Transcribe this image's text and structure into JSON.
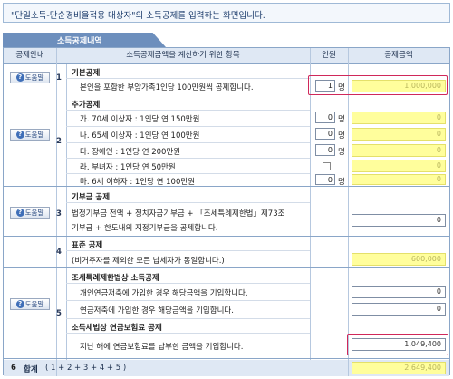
{
  "banner": "\"단일소득-단순경비율적용 대상자\"의 소득공제를 입력하는 화면입니다.",
  "section_title": "소득공제내역",
  "headers": {
    "guide": "공제안내",
    "items": "소득공제금액을 계산하기 위한 항목",
    "people": "인원",
    "amount": "공제금액"
  },
  "help_label": "도움말",
  "rows": {
    "r1": {
      "num": "1",
      "title": "기본공제",
      "desc": "본인을 포함한 부양가족1인당 100만원씩 공제합니다.",
      "count": "1",
      "amount": "1,000,000"
    },
    "r2": {
      "num": "2",
      "title": "추가공제",
      "lines": [
        {
          "text": "가. 70세 이상자 : 1인당 연 150만원",
          "count": "0",
          "amount": "0"
        },
        {
          "text": "나. 65세 이상자 : 1인당 연 100만원",
          "count": "0",
          "amount": "0"
        },
        {
          "text": "다. 장애인      : 1인당 연 200만원",
          "count": "0",
          "amount": "0"
        },
        {
          "text": "라. 부녀자      : 1인당 연  50만원",
          "amount": "0"
        },
        {
          "text": "마. 6세  이하자 : 1인당 연 100만원",
          "count": "0",
          "amount": "0"
        }
      ]
    },
    "r3": {
      "num": "3",
      "title": "기부금 공제",
      "desc1": "법정기부금 전액 + 정치자금기부금 + 「조세특례제한법」제73조",
      "desc2": "기부금 + 한도내의 지정기부금을 공제합니다.",
      "amount": "0"
    },
    "r4": {
      "num": "4",
      "title": "표준 공제",
      "desc": "(비거주자를 제외한 모든 납세자가 동일합니다.)",
      "amount": "600,000"
    },
    "r5": {
      "num": "5",
      "title": "조세특례제한법상 소득공제",
      "desc1": "개인연금저축에 가입한 경우 해당금액을 기입합니다.",
      "amount1": "0",
      "desc2": "연금저축에 가입한 경우 해당금액을 기입합니다.",
      "amount2": "0",
      "title2": "소득세법상 연금보험료 공제",
      "desc3": "지난 해에 연금보험료를 납부한 금액을 기입합니다.",
      "amount3": "1,049,400"
    },
    "r6": {
      "num": "6",
      "title": "합계",
      "formula": "( 1 + 2 + 3 + 4 + 5 )",
      "amount": "2,649,400"
    }
  },
  "unit_person": "명"
}
